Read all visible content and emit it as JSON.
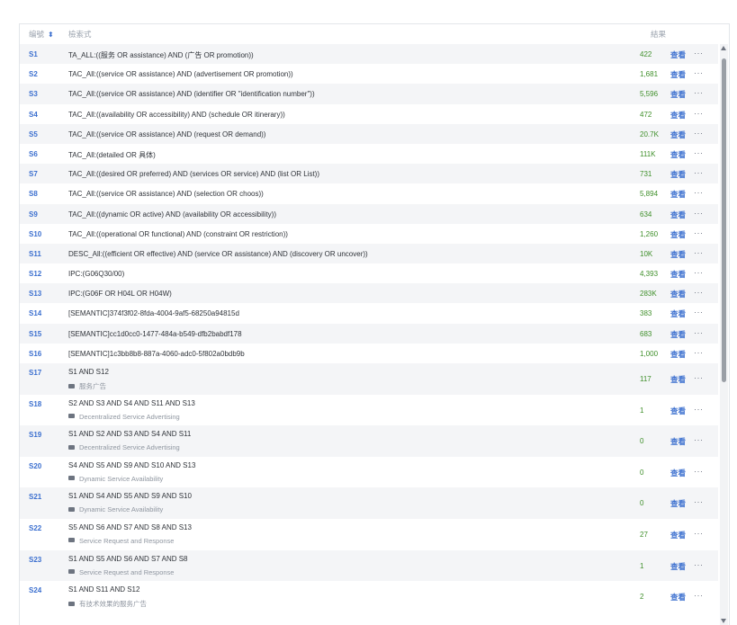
{
  "header": {
    "num": "编號",
    "query": "檢索式",
    "result": "結果"
  },
  "actions": {
    "view": "查看",
    "more": "···"
  },
  "rows": [
    {
      "id": "S1",
      "query": "TA_ALL:((服务 OR assistance) AND (广告 OR promotion))",
      "count": "422"
    },
    {
      "id": "S2",
      "query": "TAC_All:((service OR assistance) AND (advertisement OR promotion))",
      "count": "1,681"
    },
    {
      "id": "S3",
      "query": "TAC_All:((service OR assistance) AND (identifier OR \"identification number\"))",
      "count": "5,596"
    },
    {
      "id": "S4",
      "query": "TAC_All:((availability OR accessibility) AND (schedule OR itinerary))",
      "count": "472"
    },
    {
      "id": "S5",
      "query": "TAC_All:((service OR assistance) AND (request OR demand))",
      "count": "20.7K"
    },
    {
      "id": "S6",
      "query": "TAC_All:(detailed OR 具体)",
      "count": "111K"
    },
    {
      "id": "S7",
      "query": "TAC_All:((desired OR preferred) AND (services OR service) AND (list OR List))",
      "count": "731"
    },
    {
      "id": "S8",
      "query": "TAC_All:((service OR assistance) AND (selection OR choos))",
      "count": "5,894"
    },
    {
      "id": "S9",
      "query": "TAC_All:((dynamic OR active) AND (availability OR accessibility))",
      "count": "634"
    },
    {
      "id": "S10",
      "query": "TAC_All:((operational OR functional) AND (constraint OR restriction))",
      "count": "1,260"
    },
    {
      "id": "S11",
      "query": "DESC_All:((efficient OR effective) AND (service OR assistance) AND (discovery OR uncover))",
      "count": "10K"
    },
    {
      "id": "S12",
      "query": "IPC:(G06Q30/00)",
      "count": "4,393"
    },
    {
      "id": "S13",
      "query": "IPC:(G06F OR  H04L  OR H04W)",
      "count": "283K"
    },
    {
      "id": "S14",
      "query": "[SEMANTIC]374f3f02-8fda-4004-9af5-68250a94815d",
      "count": "383"
    },
    {
      "id": "S15",
      "query": "[SEMANTIC]cc1d0cc0-1477-484a-b549-dfb2babdf178",
      "count": "683"
    },
    {
      "id": "S16",
      "query": "[SEMANTIC]1c3bb8b8-887a-4060-adc0-5f802a0bdb9b",
      "count": "1,000"
    },
    {
      "id": "S17",
      "query": "S1 AND S12",
      "note": "服务广告",
      "count": "117"
    },
    {
      "id": "S18",
      "query": "S2 AND S3 AND S4 AND S11 AND S13",
      "note": "Decentralized Service Advertising",
      "count": "1"
    },
    {
      "id": "S19",
      "query": "S1 AND S2 AND S3 AND S4 AND S11",
      "note": "Decentralized Service Advertising",
      "count": "0"
    },
    {
      "id": "S20",
      "query": "S4 AND S5 AND S9 AND S10 AND S13",
      "note": "Dynamic Service Availability",
      "count": "0"
    },
    {
      "id": "S21",
      "query": "S1 AND S4 AND S5 AND S9 AND S10",
      "note": "Dynamic Service Availability",
      "count": "0"
    },
    {
      "id": "S22",
      "query": "S5 AND S6 AND S7 AND S8 AND S13",
      "note": "Service Request and Response",
      "count": "27"
    },
    {
      "id": "S23",
      "query": "S1 AND S5 AND S6 AND S7 AND S8",
      "note": "Service Request and Response",
      "count": "1"
    },
    {
      "id": "S24",
      "query": "S1 AND S11 AND S12",
      "note": "有技术效果的服务广告",
      "count": "2"
    }
  ]
}
